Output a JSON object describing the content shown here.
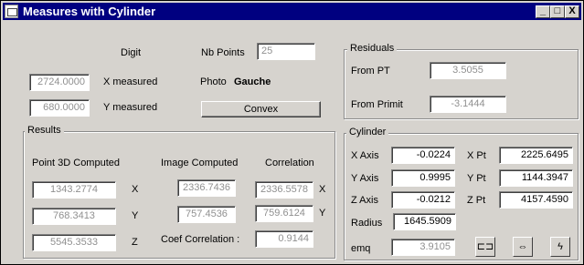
{
  "window": {
    "title": "Measures with Cylinder",
    "controls": [
      "_",
      "□",
      "X"
    ]
  },
  "top": {
    "digit_label": "Digit",
    "nb_points_label": "Nb Points",
    "nb_points_value": "25",
    "x_measured_value": "2724.0000",
    "x_measured_label": "X measured",
    "photo_label": "Photo",
    "photo_value": "Gauche",
    "y_measured_value": "680.0000",
    "y_measured_label": "Y measured",
    "convex_button": "Convex"
  },
  "residuals": {
    "title": "Residuals",
    "from_pt_label": "From PT",
    "from_pt_value": "3.5055",
    "from_primit_label": "From Primit",
    "from_primit_value": "-3.1444"
  },
  "results": {
    "title": "Results",
    "col_point3d": "Point 3D Computed",
    "col_image": "Image Computed",
    "col_correlation": "Correlation",
    "rows": [
      {
        "p3d": "1343.2774",
        "axis": "X",
        "img": "2336.7436",
        "corr": "2336.5578",
        "corr_axis": "X"
      },
      {
        "p3d": "768.3413",
        "axis": "Y",
        "img": "757.4536",
        "corr": "759.6124",
        "corr_axis": "Y"
      },
      {
        "p3d": "5545.3533",
        "axis": "Z"
      }
    ],
    "coef_label": "Coef Correlation :",
    "coef_value": "0.9144"
  },
  "cylinder": {
    "title": "Cylinder",
    "x_axis_label": "X Axis",
    "x_axis_value": "-0.0224",
    "y_axis_label": "Y Axis",
    "y_axis_value": "0.9995",
    "z_axis_label": "Z Axis",
    "z_axis_value": "-0.0212",
    "x_pt_label": "X Pt",
    "x_pt_value": "2225.6495",
    "y_pt_label": "Y Pt",
    "y_pt_value": "1144.3947",
    "z_pt_label": "Z Pt",
    "z_pt_value": "4157.4590",
    "radius_label": "Radius",
    "radius_value": "1645.5909",
    "emq_label": "emq",
    "emq_value": "3.9105",
    "icons": [
      "tool-select-icon",
      "arrows-icon",
      "lightning-icon"
    ],
    "icon_glyphs": [
      "⊏⊐",
      "⇔",
      "ϟ"
    ]
  }
}
